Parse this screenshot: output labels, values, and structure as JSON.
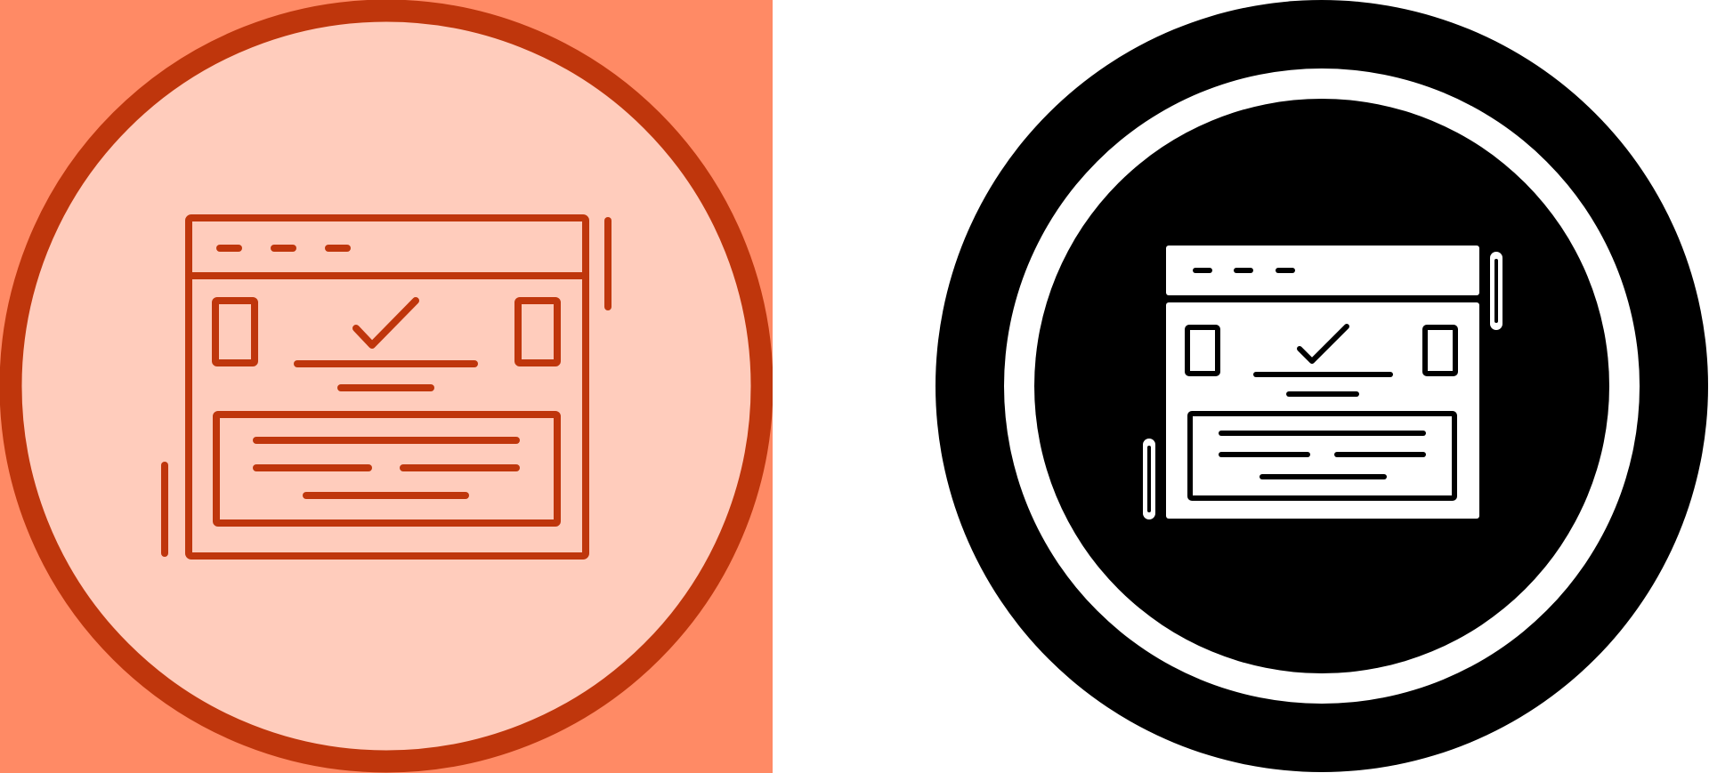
{
  "icons": {
    "left": {
      "name": "browser-check-icon",
      "style": "line",
      "colors": {
        "panel_background": "#FF8A65",
        "circle_fill": "#FFCCBC",
        "stroke": "#BF360C"
      }
    },
    "right": {
      "name": "browser-check-icon",
      "style": "glyph",
      "colors": {
        "panel_background": "#FFFFFF",
        "outer_circle": "#000000",
        "ring": "#FFFFFF",
        "inner_circle": "#000000",
        "glyph": "#FFFFFF"
      }
    }
  }
}
